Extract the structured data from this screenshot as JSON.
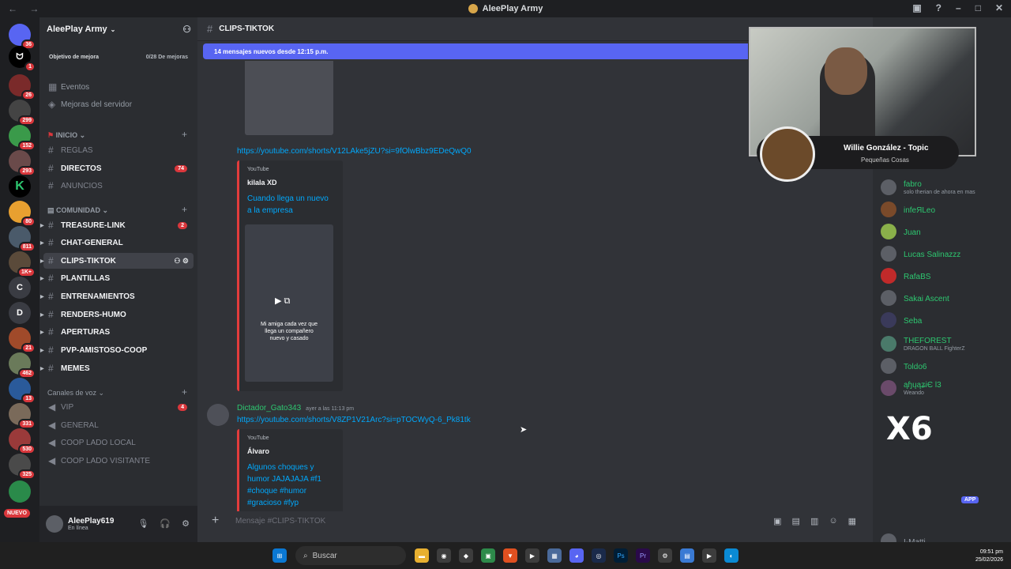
{
  "window": {
    "title": "AleePlay Army"
  },
  "servers": [
    {
      "label": "",
      "badge": "36"
    },
    {
      "label": "ᗢ",
      "badge": "1"
    },
    {
      "label": "",
      "badge": "26"
    },
    {
      "label": "",
      "badge": "299"
    },
    {
      "label": "",
      "badge": "152"
    },
    {
      "label": "",
      "badge": "293"
    },
    {
      "label": "K",
      "badge": ""
    },
    {
      "label": "",
      "badge": "80"
    },
    {
      "label": "",
      "badge": "811"
    },
    {
      "label": "",
      "badge": "1K+"
    },
    {
      "label": "C",
      "badge": ""
    },
    {
      "label": "D",
      "badge": ""
    },
    {
      "label": "",
      "badge": "21"
    },
    {
      "label": "",
      "badge": "462"
    },
    {
      "label": "",
      "badge": "13"
    },
    {
      "label": "",
      "badge": "331"
    },
    {
      "label": "",
      "badge": "530"
    },
    {
      "label": "",
      "badge": "325"
    }
  ],
  "servers_new_label": "NUEVO",
  "guild": {
    "name": "AleePlay Army",
    "boost_label": "Objetivo de mejora",
    "boost_progress": "0/28 De mejoras",
    "events": "Eventos",
    "server_boosts": "Mejoras del servidor"
  },
  "categories": {
    "inicio": "INICIO",
    "comunidad": "COMUNIDAD",
    "voz": "Canales de voz"
  },
  "channels": {
    "reglas": {
      "name": "REGLAS"
    },
    "directos": {
      "name": "DIRECTOS",
      "badge": "74"
    },
    "anuncios": {
      "name": "ANUNCIOS"
    },
    "treasure": {
      "name": "TREASURE-LINK",
      "badge": "2"
    },
    "chat_general": {
      "name": "CHAT-GENERAL"
    },
    "clips": {
      "name": "CLIPS-TIKTOK"
    },
    "plantillas": {
      "name": "PLANTILLAS"
    },
    "entrenamientos": {
      "name": "ENTRENAMIENTOS"
    },
    "renders": {
      "name": "RENDERS-HUMO"
    },
    "aperturas": {
      "name": "APERTURAS"
    },
    "pvp": {
      "name": "PVP-AMISTOSO-COOP"
    },
    "memes": {
      "name": "MEMES"
    },
    "vip": {
      "name": "VIP",
      "badge": "4"
    },
    "general": {
      "name": "GENERAL"
    },
    "coop_local": {
      "name": "COOP LADO LOCAL"
    },
    "coop_visitante": {
      "name": "COOP LADO VISITANTE"
    }
  },
  "user": {
    "name": "AleePlay619",
    "status": "En línea"
  },
  "chat": {
    "channel": "CLIPS-TIKTOK",
    "new_messages": "14 mensajes nuevos desde 12:15 p.m.",
    "link1": "https://youtube.com/shorts/V12LAke5jZU?si=9fOlwBbz9EDeQwQ0",
    "embed1": {
      "provider": "YouTube",
      "author": "kilala XD",
      "title": "Cuando llega un nuevo a la empresa",
      "caption": "Mi amiga cada vez que llega un compañero nuevo y casado"
    },
    "msg2": {
      "author": "Dictador_Gato343",
      "time": "ayer a las 11:13 pm",
      "link": "https://youtube.com/shorts/V8ZP1V21Arc?si=pTOCWyQ-6_Pk81tk"
    },
    "embed2": {
      "provider": "YouTube",
      "author": "Álvaro",
      "title": "Algunos choques y humor JAJAJAJA #f1 #choque #humor #gracioso #fyp"
    },
    "composer_placeholder": "Mensaje #CLIPS-TIKTOK"
  },
  "members": [
    {
      "name": "fabro",
      "sub": "solo therian de ahora en mas"
    },
    {
      "name": "infeЯLeo",
      "sub": ""
    },
    {
      "name": "Juan",
      "sub": ""
    },
    {
      "name": "Lucas Salinazzz",
      "sub": ""
    },
    {
      "name": "RafaBS",
      "sub": ""
    },
    {
      "name": "Sakai Ascent",
      "sub": ""
    },
    {
      "name": "Seba",
      "sub": ""
    },
    {
      "name": "THEFOREST",
      "sub": "DRAGON BALL FighterZ"
    },
    {
      "name": "Toldo6",
      "sub": ""
    },
    {
      "name": "ąɧųąʑiЄ l3",
      "sub": "Weando"
    },
    {
      "name": "I-Matti",
      "sub": ""
    }
  ],
  "overlay": {
    "track": "Willie González - Topic",
    "artist": "Pequeñas Cosas",
    "multiplier": "X6",
    "app_badge": "APP"
  },
  "taskbar": {
    "search": "Buscar",
    "time": "09:51 pm",
    "date": "25/02/2026"
  }
}
